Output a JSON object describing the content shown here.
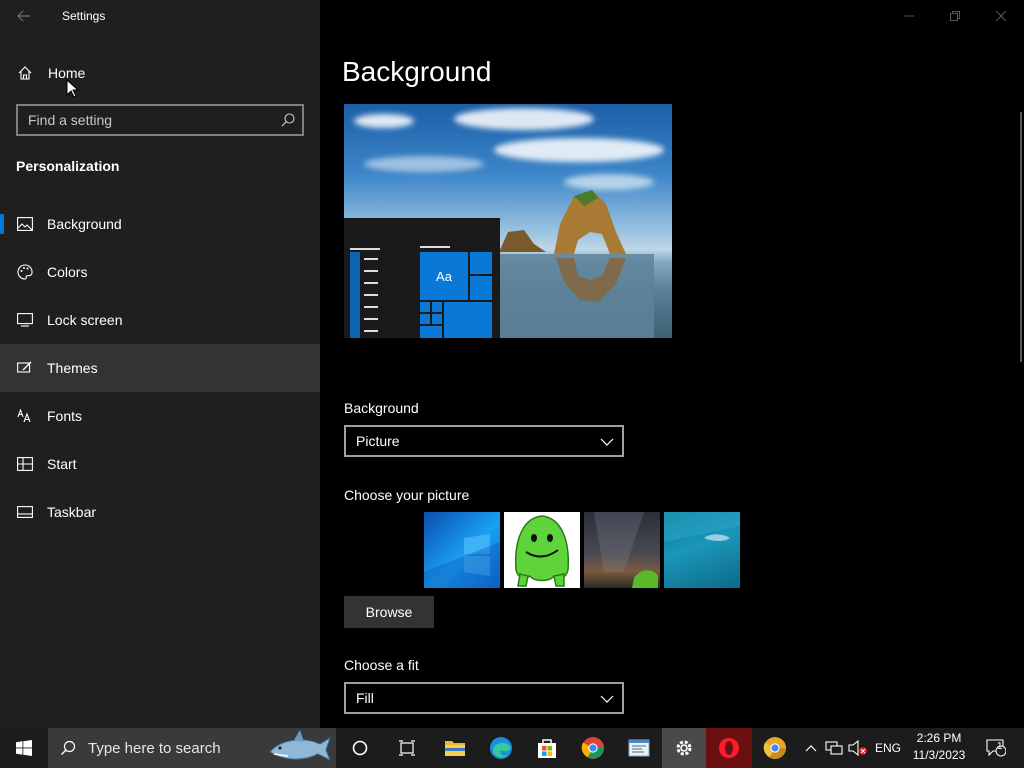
{
  "window": {
    "app_title": "Settings",
    "back_icon": "arrow-left-icon",
    "controls": [
      "minimize-icon",
      "restore-icon",
      "close-icon"
    ]
  },
  "sidebar": {
    "home_label": "Home",
    "search_placeholder": "Find a setting",
    "section_title": "Personalization",
    "selected_index": 0,
    "hover_index": 3,
    "items": [
      {
        "label": "Background",
        "icon": "picture-icon"
      },
      {
        "label": "Colors",
        "icon": "palette-icon"
      },
      {
        "label": "Lock screen",
        "icon": "lock-screen-icon"
      },
      {
        "label": "Themes",
        "icon": "brush-icon"
      },
      {
        "label": "Fonts",
        "icon": "font-icon"
      },
      {
        "label": "Start",
        "icon": "start-icon"
      },
      {
        "label": "Taskbar",
        "icon": "taskbar-icon"
      }
    ]
  },
  "main": {
    "page_title": "Background",
    "preview": {
      "tile_text": "Aa"
    },
    "background_label": "Background",
    "background_value": "Picture",
    "choose_picture_label": "Choose your picture",
    "pictures": [
      "windows-10-wallpaper",
      "green-jelly-character",
      "night-sky-milky-way",
      "underwater-ocean"
    ],
    "browse_label": "Browse",
    "fit_label": "Choose a fit",
    "fit_value": "Fill"
  },
  "taskbar": {
    "search_placeholder": "Type here to search",
    "pinned": [
      "cortana-icon",
      "task-view-icon",
      "file-explorer-icon",
      "edge-icon",
      "store-icon",
      "chrome-icon",
      "notepad-icon",
      "settings-icon",
      "opera-icon",
      "chrome-canary-icon"
    ],
    "active": "settings-icon",
    "language": "ENG",
    "time": "2:26 PM",
    "date": "11/3/2023",
    "notification_count": "1"
  },
  "colors": {
    "accent": "#0078d7",
    "sidebar_bg": "#1f1f1f",
    "content_bg": "#000000",
    "taskbar_bg": "#1c1c1c"
  }
}
